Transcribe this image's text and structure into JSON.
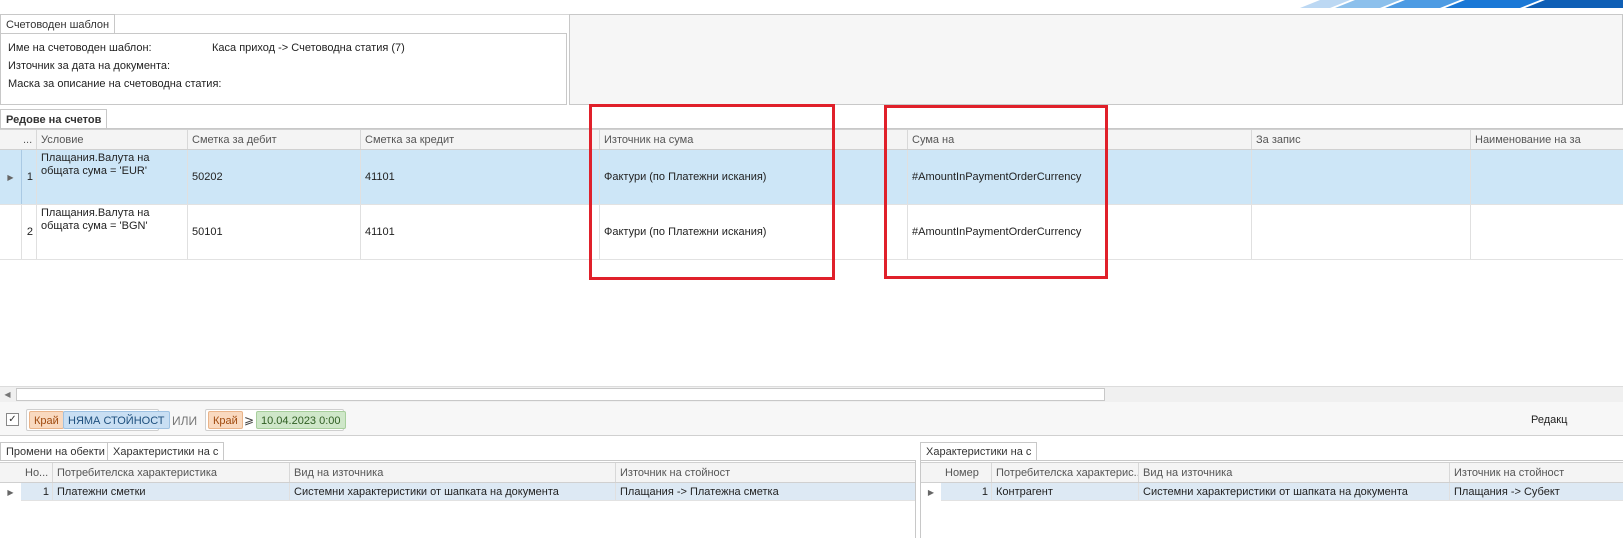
{
  "template_tab": {
    "label": "Счетоводен шаблон"
  },
  "template_fields": [
    {
      "label": "Име на счетоводен шаблон:",
      "value": "Каса приход -> Счетоводна статия (7)"
    },
    {
      "label": "Източник за дата на документа:",
      "value": ""
    },
    {
      "label": "Маска за описание на счетоводна статия:",
      "value": ""
    }
  ],
  "rows_tab": {
    "label": "Редове на счетов"
  },
  "main_grid": {
    "columns": [
      "...",
      "Условие",
      "Сметка за дебит",
      "Сметка за кредит",
      "Източник на сума",
      "Сума на",
      "За запис",
      "Наименование на за"
    ],
    "rows": [
      {
        "num": "1",
        "condition": "Плащания.Валута на общата сума = 'EUR'",
        "debit": "50202",
        "credit": "41101",
        "source": "Фактури (по Платежни искания)",
        "amount": "#AmountInPaymentOrderCurrency",
        "record": "",
        "name": ""
      },
      {
        "num": "2",
        "condition": "Плащания.Валута на общата сума = 'BGN'",
        "debit": "50101",
        "credit": "41101",
        "source": "Фактури (по Платежни искания)",
        "amount": "#AmountInPaymentOrderCurrency",
        "record": "",
        "name": ""
      }
    ]
  },
  "filter": {
    "chip1": "Край",
    "chip2": "НЯМА СТОЙНОСТ",
    "or": "ИЛИ",
    "chip3": "Край",
    "op": "⩾",
    "chip4": "10.04.2023 0:00",
    "edit_label": "Редакц"
  },
  "bottom_left_tabs": [
    "Промени на обекти",
    "Характеристики на с"
  ],
  "bottom_left_grid": {
    "columns": [
      "Но...",
      "Потребителска характеристика",
      "Вид на източника",
      "Източник на стойност"
    ],
    "rows": [
      {
        "num": "1",
        "char": "Платежни сметки",
        "kind": "Системни характеристики от шапката на документа",
        "source": "Плащания -> Платежна сметка"
      }
    ]
  },
  "bottom_right_tab": "Характеристики на с",
  "bottom_right_grid": {
    "columns": [
      "Номер",
      "Потребителска характерис...",
      "Вид на източника",
      "Източник на стойност"
    ],
    "rows": [
      {
        "num": "1",
        "char": "Контрагент",
        "kind": "Системни характеристики от шапката на документа",
        "source": "Плащания -> Субект"
      }
    ]
  },
  "colors": {
    "selection": "#cde6f7",
    "highlight": "#e0202a",
    "accent_blue": "#1a78d6"
  }
}
